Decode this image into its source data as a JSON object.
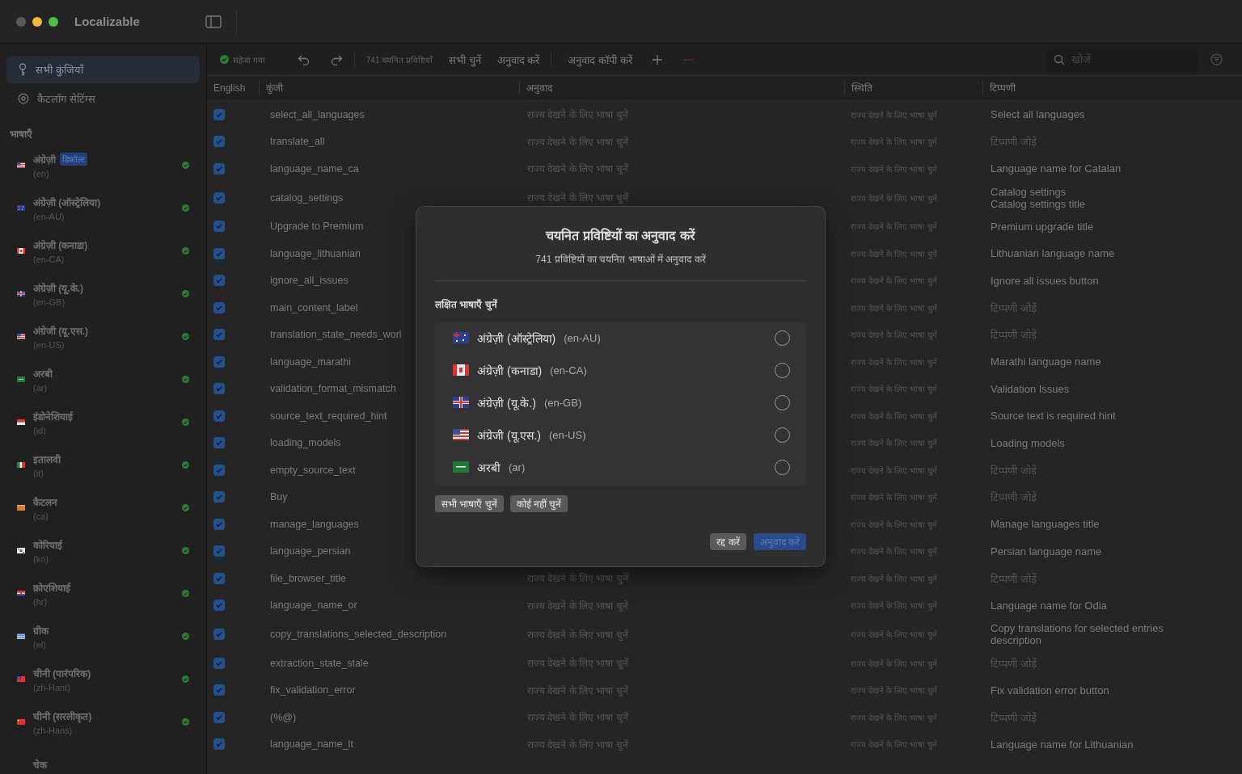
{
  "window": {
    "title": "Localizable"
  },
  "sidebar": {
    "items": [
      {
        "label": "सभी कुंजियाँ",
        "selected": true
      },
      {
        "label": "कैटलॉग सेटिंग्स",
        "selected": false
      }
    ],
    "languages_heading": "भाषाएँ",
    "languages": [
      {
        "name": "अंग्रेज़ी",
        "code": "(en)",
        "badge": "डिफ़ॉल्ट",
        "kind": "us",
        "complete": true
      },
      {
        "name": "अंग्रेज़ी (ऑस्ट्रेलिया)",
        "code": "(en-AU)",
        "kind": "au",
        "complete": true
      },
      {
        "name": "अंग्रेज़ी (कनाडा)",
        "code": "(en-CA)",
        "kind": "ca",
        "complete": true
      },
      {
        "name": "अंग्रेज़ी (यू.के.)",
        "code": "(en-GB)",
        "kind": "gb",
        "complete": true
      },
      {
        "name": "अंग्रेजी (यू.एस.)",
        "code": "(en-US)",
        "kind": "us",
        "complete": true
      },
      {
        "name": "अरबी",
        "code": "(ar)",
        "kind": "sa",
        "complete": true
      },
      {
        "name": "इंडोनेशियाई",
        "code": "(id)",
        "kind": "id",
        "complete": true
      },
      {
        "name": "इतालवी",
        "code": "(it)",
        "kind": "it",
        "complete": true
      },
      {
        "name": "कैटलन",
        "code": "(ca)",
        "kind": "ct",
        "complete": true
      },
      {
        "name": "कोरियाई",
        "code": "(ko)",
        "kind": "kr",
        "complete": true
      },
      {
        "name": "क्रोएशियाई",
        "code": "(hr)",
        "kind": "hr",
        "complete": true
      },
      {
        "name": "ग्रीक",
        "code": "(el)",
        "kind": "gr",
        "complete": true
      },
      {
        "name": "चीनी (पारंपरिक)",
        "code": "(zh-Hant)",
        "kind": "tw",
        "complete": true
      },
      {
        "name": "चीनी (सरलीकृत)",
        "code": "(zh-Hans)",
        "kind": "cn",
        "complete": true
      },
      {
        "name": "चेक"
      }
    ]
  },
  "toolbar": {
    "status": "सहेजा गया",
    "selection": "741 चयनित प्रविष्टियाँ",
    "buttons": [
      "सभी चुनें",
      "अनुवाद करें",
      "अनुवाद कॉपी करें"
    ],
    "search": {
      "placeholder": "खोजें"
    }
  },
  "table": {
    "columns": [
      "English",
      "कुंजी",
      "अनुवाद",
      "स्थिति",
      "टिप्पणी"
    ],
    "rows": [
      {
        "checked": true,
        "key": "select_all_languages",
        "translation": "राज्य देखने के लिए भाषा चुनें",
        "status": "राज्य देखने के लिए भाषा चुनें",
        "comments": [
          "Select all languages"
        ],
        "comment_hint": false
      },
      {
        "checked": true,
        "key": "translate_all",
        "translation": "राज्य देखने के लिए भाषा चुनें",
        "status": "राज्य देखने के लिए भाषा चुनें",
        "comments": [
          "टिप्पणी जोड़ें"
        ],
        "comment_hint": true
      },
      {
        "checked": true,
        "key": "language_name_ca",
        "translation": "राज्य देखने के लिए भाषा चुनें",
        "status": "राज्य देखने के लिए भाषा चुनें",
        "comments": [
          "Language name for Catalan"
        ],
        "comment_hint": false
      },
      {
        "checked": true,
        "key": "catalog_settings",
        "translation": "राज्य देखने के लिए भाषा चुनें",
        "status": "राज्य देखने के लिए भाषा चुनें",
        "comments": [
          "Catalog settings",
          "Catalog settings title"
        ],
        "comment_hint": false
      },
      {
        "checked": true,
        "key": "Upgrade to Premium",
        "status": "राज्य देखने के लिए भाषा चुनें",
        "comments": [
          "Premium upgrade title"
        ],
        "comment_hint": false
      },
      {
        "checked": true,
        "key": "language_lithuanian",
        "status": "राज्य देखने के लिए भाषा चुनें",
        "comments": [
          "Lithuanian language name"
        ],
        "comment_hint": false
      },
      {
        "checked": true,
        "key": "ignore_all_issues",
        "status": "राज्य देखने के लिए भाषा चुनें",
        "comments": [
          "Ignore all issues button"
        ],
        "comment_hint": false
      },
      {
        "checked": true,
        "key": "main_content_label",
        "status": "राज्य देखने के लिए भाषा चुनें",
        "comments": [
          "टिप्पणी जोड़ें"
        ],
        "comment_hint": true
      },
      {
        "checked": true,
        "key": "translation_state_needs_worl",
        "status": "राज्य देखने के लिए भाषा चुनें",
        "comments": [
          "टिप्पणी जोड़ें"
        ],
        "comment_hint": true
      },
      {
        "checked": true,
        "key": "language_marathi",
        "status": "राज्य देखने के लिए भाषा चुनें",
        "comments": [
          "Marathi language name"
        ],
        "comment_hint": false
      },
      {
        "checked": true,
        "key": "validation_format_mismatch",
        "status": "राज्य देखने के लिए भाषा चुनें",
        "comments": [
          "Validation Issues"
        ],
        "comment_hint": false
      },
      {
        "checked": true,
        "key": "source_text_required_hint",
        "status": "राज्य देखने के लिए भाषा चुनें",
        "comments": [
          "Source text is required hint"
        ],
        "comment_hint": false
      },
      {
        "checked": true,
        "key": "loading_models",
        "status": "राज्य देखने के लिए भाषा चुनें",
        "comments": [
          "Loading models"
        ],
        "comment_hint": false
      },
      {
        "checked": true,
        "key": "empty_source_text",
        "status": "राज्य देखने के लिए भाषा चुनें",
        "comments": [
          "टिप्पणी जोड़ें"
        ],
        "comment_hint": true
      },
      {
        "checked": true,
        "key": "Buy",
        "status": "राज्य देखने के लिए भाषा चुनें",
        "comments": [
          "टिप्पणी जोड़ें"
        ],
        "comment_hint": true
      },
      {
        "checked": true,
        "key": "manage_languages",
        "status": "राज्य देखने के लिए भाषा चुनें",
        "comments": [
          "Manage languages title"
        ],
        "comment_hint": false
      },
      {
        "checked": true,
        "key": "language_persian",
        "status": "राज्य देखने के लिए भाषा चुनें",
        "comments": [
          "Persian language name"
        ],
        "comment_hint": false
      },
      {
        "checked": true,
        "key": "file_browser_title",
        "translation": "राज्य देखने के लिए भाषा चुनें",
        "status": "राज्य देखने के लिए भाषा चुनें",
        "comments": [
          "टिप्पणी जोड़ें"
        ],
        "comment_hint": true
      },
      {
        "checked": true,
        "key": "language_name_or",
        "translation": "राज्य देखने के लिए भाषा चुनें",
        "status": "राज्य देखने के लिए भाषा चुनें",
        "comments": [
          "Language name for Odia"
        ],
        "comment_hint": false
      },
      {
        "checked": true,
        "key": "copy_translations_selected_description",
        "translation": "राज्य देखने के लिए भाषा चुनें",
        "status": "राज्य देखने के लिए भाषा चुनें",
        "comments": [
          "Copy translations for selected entries description"
        ],
        "comment_hint": false
      },
      {
        "checked": true,
        "key": "extraction_state_stale",
        "translation": "राज्य देखने के लिए भाषा चुनें",
        "status": "राज्य देखने के लिए भाषा चुनें",
        "comments": [
          "टिप्पणी जोड़ें"
        ],
        "comment_hint": true
      },
      {
        "checked": true,
        "key": "fix_validation_error",
        "translation": "राज्य देखने के लिए भाषा चुनें",
        "status": "राज्य देखने के लिए भाषा चुनें",
        "comments": [
          "Fix validation error button"
        ],
        "comment_hint": false
      },
      {
        "checked": true,
        "key": "(%@)",
        "translation": "राज्य देखने के लिए भाषा चुनें",
        "status": "राज्य देखने के लिए भाषा चुनें",
        "comments": [
          "टिप्पणी जोड़ें"
        ],
        "comment_hint": true
      },
      {
        "checked": true,
        "key": "language_name_lt",
        "translation": "राज्य देखने के लिए भाषा चुनें",
        "status": "राज्य देखने के लिए भाषा चुनें",
        "comments": [
          "Language name for Lithuanian"
        ],
        "comment_hint": false
      }
    ]
  },
  "dialog": {
    "title": "चयनित प्रविष्टियों का अनुवाद करें",
    "subtitle": "741 प्रविष्टियों का चयनित भाषाओं में अनुवाद करें",
    "section": "लक्षित भाषाएँ चुनें",
    "languages": [
      {
        "name": "अंग्रेज़ी (ऑस्ट्रेलिया)",
        "code": "(en-AU)",
        "kind": "au",
        "selected": false
      },
      {
        "name": "अंग्रेज़ी (कनाडा)",
        "code": "(en-CA)",
        "kind": "ca",
        "selected": false
      },
      {
        "name": "अंग्रेज़ी (यू.के.)",
        "code": "(en-GB)",
        "kind": "gb",
        "selected": false
      },
      {
        "name": "अंग्रेजी (यू.एस.)",
        "code": "(en-US)",
        "kind": "us",
        "selected": false
      },
      {
        "name": "अरबी",
        "code": "(ar)",
        "kind": "sa",
        "selected": false
      }
    ],
    "select_buttons": [
      "सभी भाषाएँ चुनें",
      "कोई नहीं चुनें"
    ],
    "cancel": "रद्द करें",
    "confirm": {
      "label": "अनुवाद करें",
      "disabled": true
    }
  }
}
